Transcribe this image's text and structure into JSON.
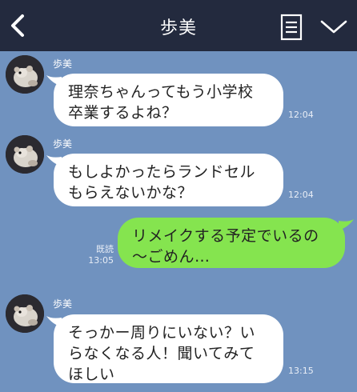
{
  "header": {
    "title": "歩美",
    "back_icon": "chevron-left-icon",
    "menu_icon": "note-list-icon",
    "dropdown_icon": "chevron-down-icon",
    "background": "#232a3e"
  },
  "chat": {
    "background": "#7092bf",
    "messages": [
      {
        "direction": "incoming",
        "sender": "歩美",
        "text": "理奈ちゃんってもう小学校\n卒業するよね？",
        "time": "12:04"
      },
      {
        "direction": "incoming",
        "sender": "歩美",
        "text": "もしよかったらランドセル\nもらえないかな？",
        "time": "12:04"
      },
      {
        "direction": "outgoing",
        "text": "リメイクする予定でいるの\n〜ごめん…",
        "read_label": "既読",
        "time": "13:05"
      },
      {
        "direction": "incoming",
        "sender": "歩美",
        "text": "そっかー周りにいない？い\nらなくなる人！聞いてみて\nほしい",
        "time": "13:15"
      }
    ]
  },
  "colors": {
    "incoming_bubble": "#ffffff",
    "outgoing_bubble": "#85e44f"
  }
}
